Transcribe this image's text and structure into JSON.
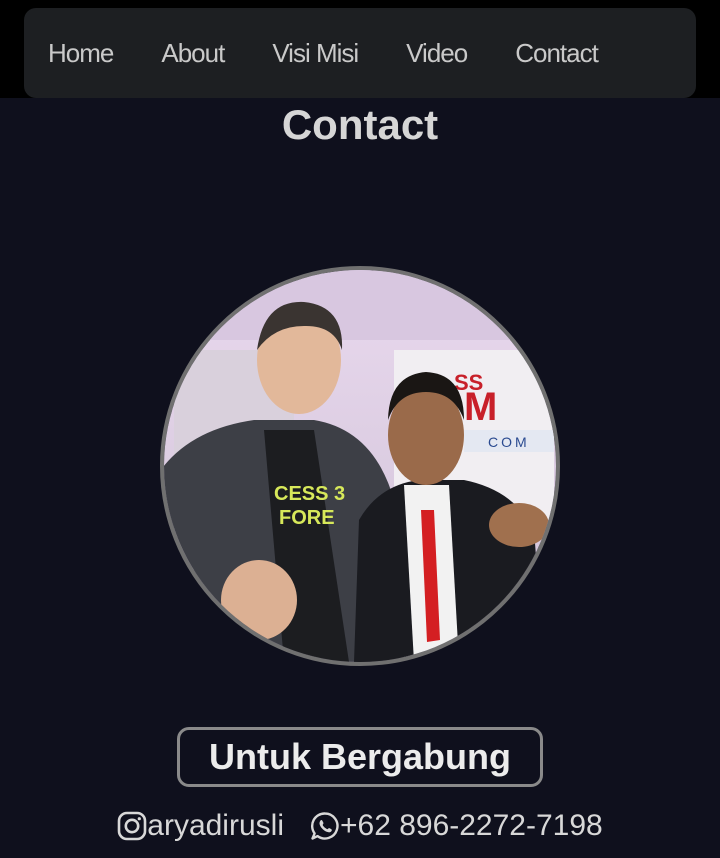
{
  "nav": {
    "items": [
      {
        "label": "Home"
      },
      {
        "label": "About"
      },
      {
        "label": "Visi Misi"
      },
      {
        "label": "Video"
      },
      {
        "label": "Contact"
      }
    ]
  },
  "page": {
    "title": "Contact"
  },
  "profile": {
    "photo_icon": "profile-photo",
    "shirt_text": "CESS FORE 3"
  },
  "cta": {
    "join_label": "Untuk Bergabung"
  },
  "contacts": {
    "instagram": {
      "icon": "instagram-icon",
      "handle": "aryadirusli"
    },
    "whatsapp": {
      "icon": "whatsapp-icon",
      "phone": "+62 896-2272-7198"
    }
  },
  "colors": {
    "background": "#0f101d",
    "navbar": "#1d1f22",
    "nav_text": "#c9c9c9",
    "title": "#d6d6d6",
    "button_border": "#8a8a8a"
  }
}
